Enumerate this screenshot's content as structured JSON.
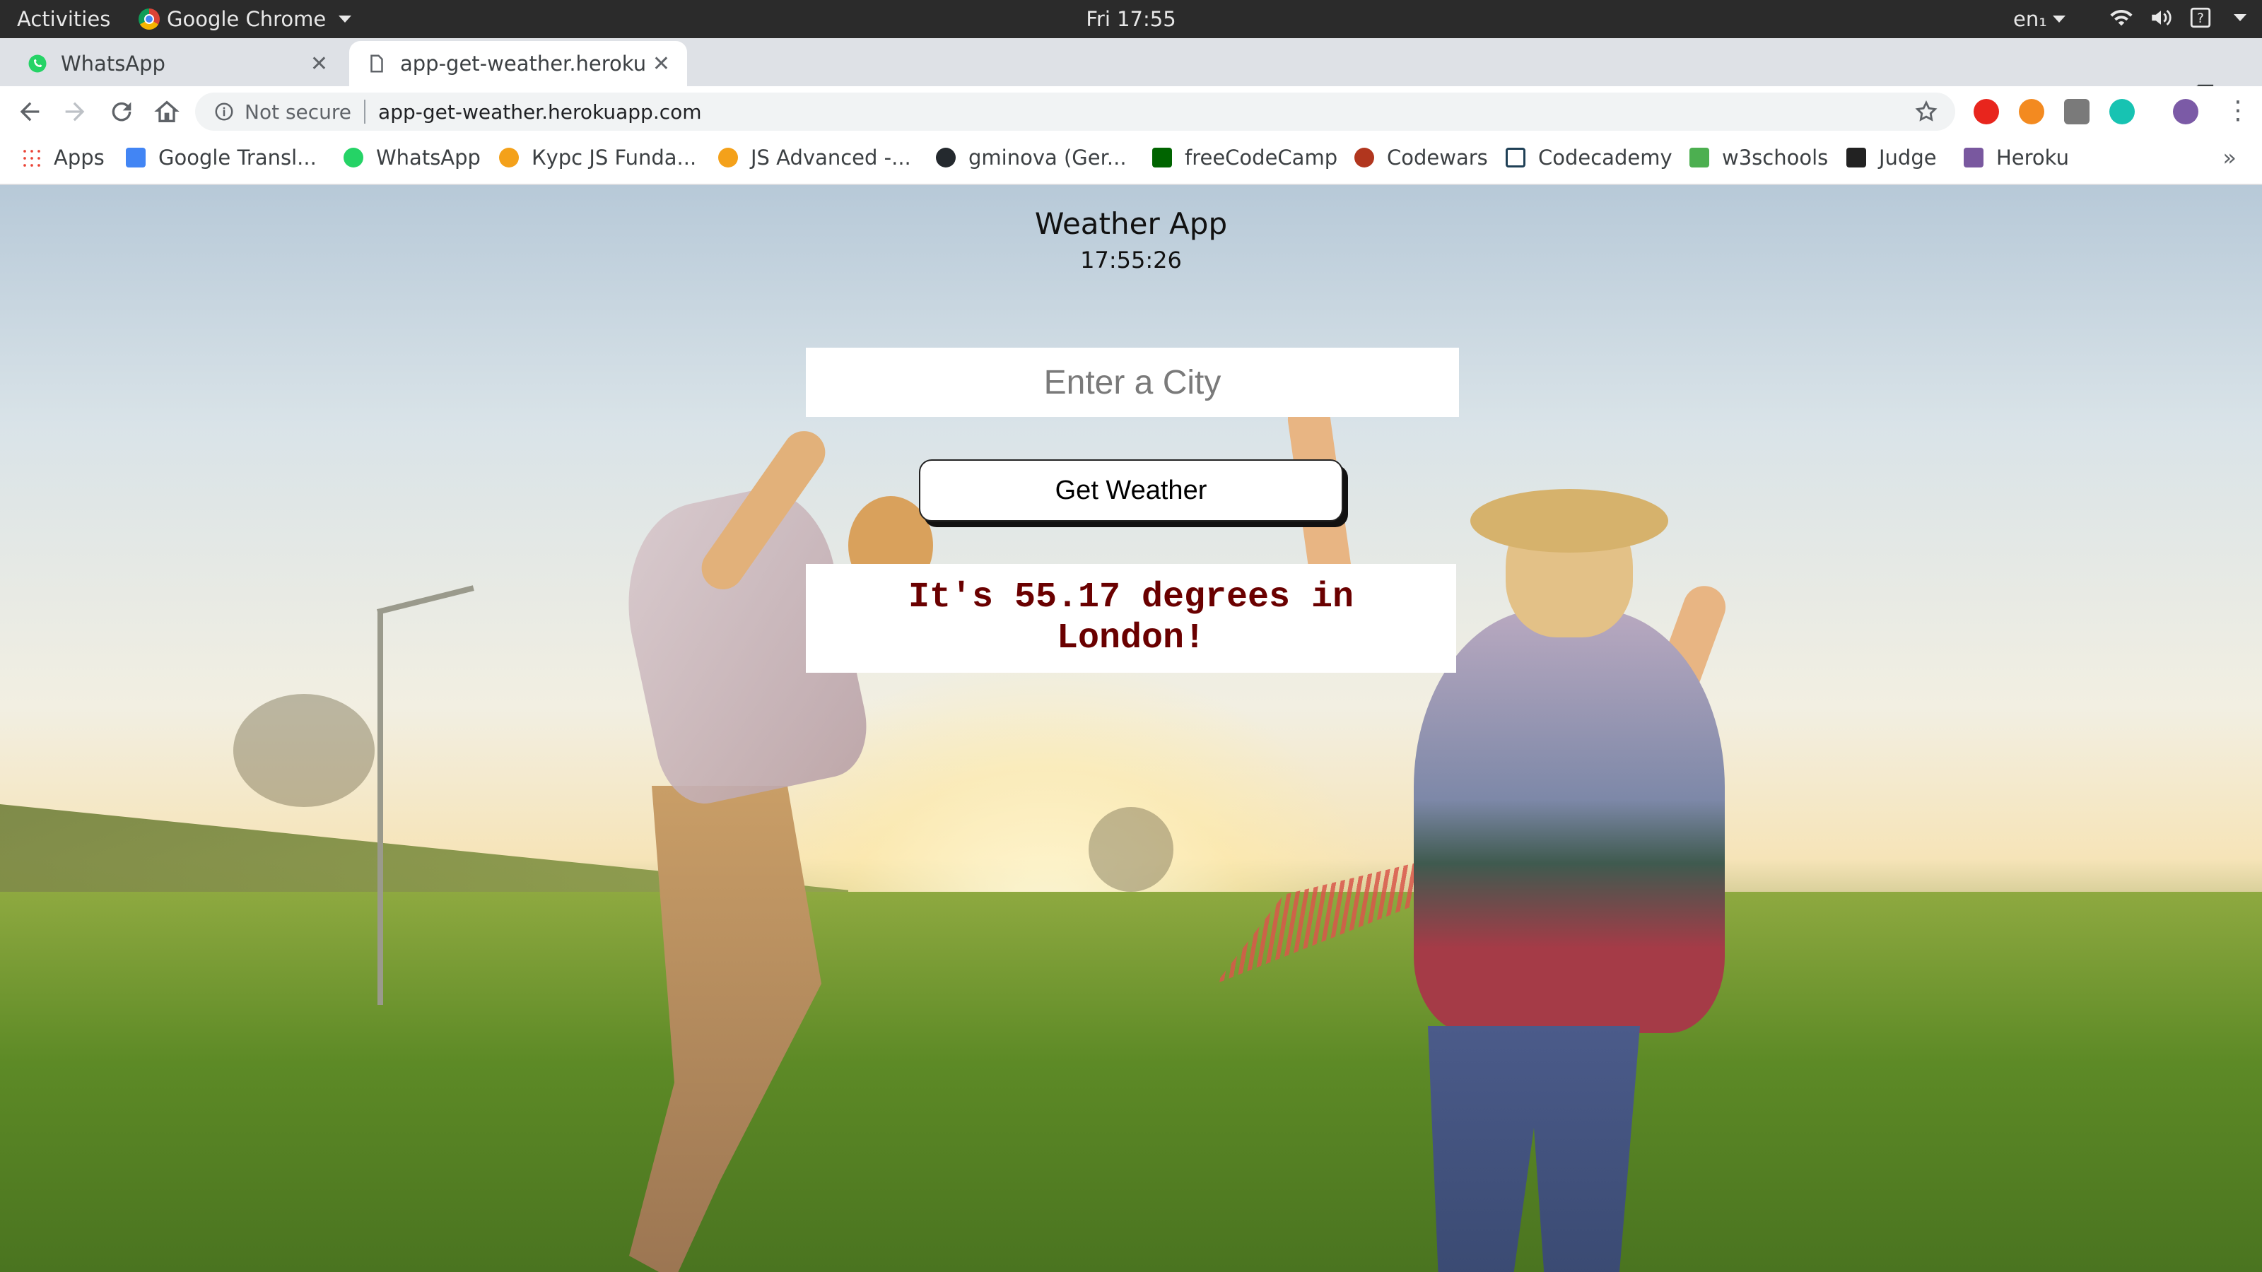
{
  "os_bar": {
    "activities": "Activities",
    "app_name": "Google Chrome",
    "clock": "Fri 17:55",
    "language": "en₁"
  },
  "browser": {
    "tabs": [
      {
        "title": "WhatsApp",
        "icon": "whatsapp-icon"
      },
      {
        "title": "app-get-weather.herokua",
        "icon": "page-icon"
      }
    ],
    "security_label": "Not secure",
    "url": "app-get-weather.herokuapp.com",
    "bookmarks": [
      {
        "label": "Apps",
        "icon": "apps-grid-icon",
        "color": "#4285f4"
      },
      {
        "label": "Google Transl...",
        "icon": "google-translate-icon",
        "color": "#4285f4"
      },
      {
        "label": "WhatsApp",
        "icon": "whatsapp-icon",
        "color": "#25d366"
      },
      {
        "label": "Курс JS Funda...",
        "icon": "softuni-icon",
        "color": "#f4a11a"
      },
      {
        "label": "JS Advanced -...",
        "icon": "softuni-icon",
        "color": "#f4a11a"
      },
      {
        "label": "gminova (Ger...",
        "icon": "github-icon",
        "color": "#24292e"
      },
      {
        "label": "freeCodeCamp",
        "icon": "freecodecamp-icon",
        "color": "#006400"
      },
      {
        "label": "Codewars",
        "icon": "codewars-icon",
        "color": "#b1361e"
      },
      {
        "label": "Codecademy",
        "icon": "codecademy-icon",
        "color": "#1f4056"
      },
      {
        "label": "w3schools",
        "icon": "w3schools-icon",
        "color": "#4caf50"
      },
      {
        "label": "Judge",
        "icon": "judge-icon",
        "color": "#222222"
      },
      {
        "label": "Heroku",
        "icon": "heroku-icon",
        "color": "#79589f"
      }
    ]
  },
  "app": {
    "title": "Weather App",
    "time": "17:55:26",
    "city_placeholder": "Enter a City",
    "city_value": "",
    "button_label": "Get Weather",
    "result": "It's 55.17 degrees in London!"
  },
  "colors": {
    "result_text": "#6a0000",
    "os_bar": "#2b2b2b",
    "tabstrip": "#dee1e6"
  }
}
